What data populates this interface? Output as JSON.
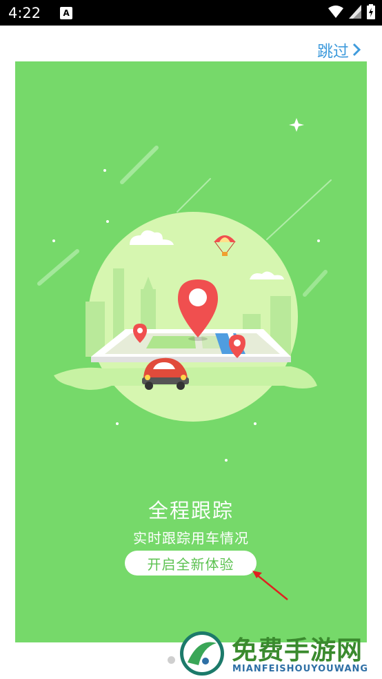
{
  "status_bar": {
    "time": "4:22",
    "notification_icon": "accessibility-a-icon",
    "right_icons": [
      "wifi-icon",
      "signal-icon",
      "battery-icon"
    ]
  },
  "header": {
    "skip_label": "跳过",
    "skip_icon": "chevron-right-icon"
  },
  "onboarding": {
    "title": "全程跟踪",
    "subtitle": "实时跟踪用车情况",
    "cta_label": "开启全新体验",
    "illustration": "map-tracking-illustration",
    "pages_total": 2,
    "current_page": 2
  },
  "watermark": {
    "name": "免费手游网",
    "sub": "MIANFEISHOUYOUWANG"
  },
  "colors": {
    "card_green": "#76d96a",
    "skip_blue": "#3f9bdc",
    "pin_red": "#f04f4f"
  }
}
